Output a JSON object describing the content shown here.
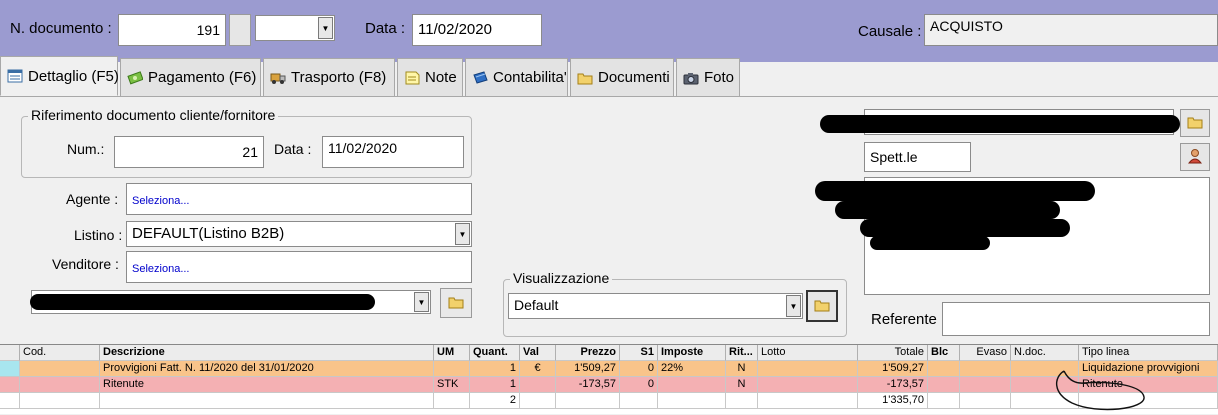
{
  "header": {
    "doc_number_label": "N. documento :",
    "doc_number": "191",
    "date_label": "Data :",
    "date": "11/02/2020",
    "causale_label": "Causale :",
    "causale": "ACQUISTO"
  },
  "tabs": [
    {
      "label": "Dettaglio (F5)",
      "icon": "detail-icon"
    },
    {
      "label": "Pagamento (F6)",
      "icon": "money-icon"
    },
    {
      "label": "Trasporto (F8)",
      "icon": "truck-icon"
    },
    {
      "label": "Note",
      "icon": "note-icon"
    },
    {
      "label": "Contabilita'",
      "icon": "book-icon"
    },
    {
      "label": "Documenti",
      "icon": "folder-icon"
    },
    {
      "label": "Foto",
      "icon": "camera-icon"
    }
  ],
  "reference": {
    "title": "Riferimento documento cliente/fornitore",
    "num_label": "Num.:",
    "num": "21",
    "date_label": "Data :",
    "date": "11/02/2020"
  },
  "agente": {
    "label": "Agente :",
    "value": "Seleziona..."
  },
  "listino": {
    "label": "Listino :",
    "value": "DEFAULT(Listino B2B)"
  },
  "venditore": {
    "label": "Venditore :",
    "value": "Seleziona..."
  },
  "visualizzazione": {
    "title": "Visualizzazione",
    "value": "Default"
  },
  "client": {
    "salutation": "Spett.le",
    "referente_label": "Referente"
  },
  "grid": {
    "headers": [
      "Cod.",
      "Descrizione",
      "UM",
      "Quant.",
      "Val",
      "Prezzo",
      "S1",
      "Imposte",
      "Rit...",
      "Lotto",
      "Totale",
      "Blc",
      "Evaso",
      "N.doc.",
      "Tipo linea"
    ],
    "rows": [
      {
        "cod": "",
        "descrizione": "Provvigioni Fatt. N. 11/2020 del 31/01/2020",
        "um": "",
        "quant": "1",
        "val": "€",
        "prezzo": "1'509,27",
        "s1": "0",
        "imposte": "22%",
        "rit": "N",
        "lotto": "",
        "totale": "1'509,27",
        "blc": "",
        "evaso": "",
        "ndoc": "",
        "tipo": "Liquidazione provvigioni"
      },
      {
        "cod": "",
        "descrizione": "Ritenute",
        "um": "STK",
        "quant": "1",
        "val": "",
        "prezzo": "-173,57",
        "s1": "0",
        "imposte": "",
        "rit": "N",
        "lotto": "",
        "totale": "-173,57",
        "blc": "",
        "evaso": "",
        "ndoc": "",
        "tipo": "Ritenute"
      },
      {
        "cod": "",
        "descrizione": "",
        "um": "",
        "quant": "2",
        "val": "",
        "prezzo": "",
        "s1": "",
        "imposte": "",
        "rit": "",
        "lotto": "",
        "totale": "1'335,70",
        "blc": "",
        "evaso": "",
        "ndoc": "",
        "tipo": ""
      }
    ]
  },
  "colors": {
    "header_bg": "#9b9bd0",
    "row_orange": "#f9c48a",
    "row_pink": "#f4b0b3",
    "row_selector_cyan": "#a8e6ef"
  }
}
